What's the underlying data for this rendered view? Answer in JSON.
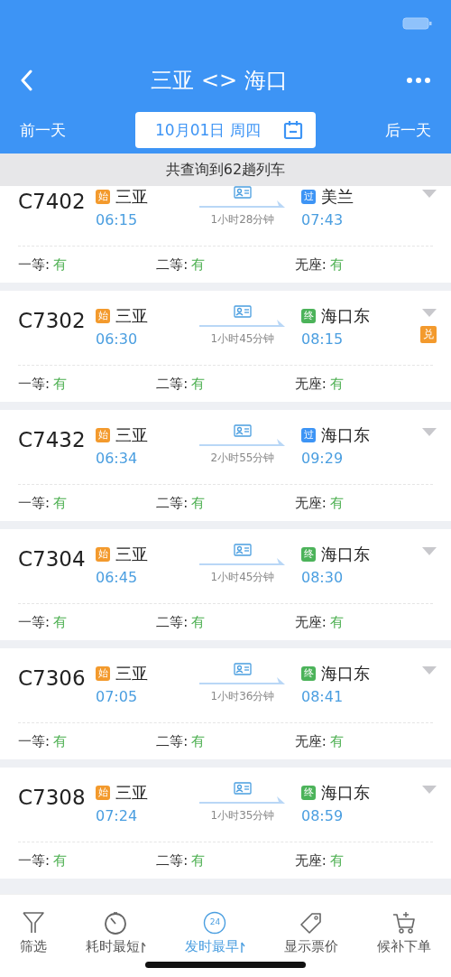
{
  "header": {
    "title": "三亚 <> 海口",
    "prev_day": "前一天",
    "date": "10月01日 周四",
    "next_day": "后一天"
  },
  "summary": "共查询到62趟列车",
  "trains": [
    {
      "number": "C7402",
      "from": {
        "badge": "始",
        "kind": "start",
        "name": "三亚"
      },
      "depart": "06:15",
      "duration": "1小时28分钟",
      "to": {
        "badge": "过",
        "kind": "pass",
        "name": "美兰"
      },
      "arrive": "07:43",
      "seats": [
        {
          "label": "一等:",
          "value": "有"
        },
        {
          "label": "二等:",
          "value": "有"
        },
        {
          "label": "无座:",
          "value": "有"
        }
      ]
    },
    {
      "number": "C7302",
      "from": {
        "badge": "始",
        "kind": "start",
        "name": "三亚"
      },
      "depart": "06:30",
      "duration": "1小时45分钟",
      "to": {
        "badge": "终",
        "kind": "end",
        "name": "海口东"
      },
      "arrive": "08:15",
      "tag": "兑",
      "seats": [
        {
          "label": "一等:",
          "value": "有"
        },
        {
          "label": "二等:",
          "value": "有"
        },
        {
          "label": "无座:",
          "value": "有"
        }
      ]
    },
    {
      "number": "C7432",
      "from": {
        "badge": "始",
        "kind": "start",
        "name": "三亚"
      },
      "depart": "06:34",
      "duration": "2小时55分钟",
      "to": {
        "badge": "过",
        "kind": "pass",
        "name": "海口东"
      },
      "arrive": "09:29",
      "seats": [
        {
          "label": "一等:",
          "value": "有"
        },
        {
          "label": "二等:",
          "value": "有"
        },
        {
          "label": "无座:",
          "value": "有"
        }
      ]
    },
    {
      "number": "C7304",
      "from": {
        "badge": "始",
        "kind": "start",
        "name": "三亚"
      },
      "depart": "06:45",
      "duration": "1小时45分钟",
      "to": {
        "badge": "终",
        "kind": "end",
        "name": "海口东"
      },
      "arrive": "08:30",
      "seats": [
        {
          "label": "一等:",
          "value": "有"
        },
        {
          "label": "二等:",
          "value": "有"
        },
        {
          "label": "无座:",
          "value": "有"
        }
      ]
    },
    {
      "number": "C7306",
      "from": {
        "badge": "始",
        "kind": "start",
        "name": "三亚"
      },
      "depart": "07:05",
      "duration": "1小时36分钟",
      "to": {
        "badge": "终",
        "kind": "end",
        "name": "海口东"
      },
      "arrive": "08:41",
      "seats": [
        {
          "label": "一等:",
          "value": "有"
        },
        {
          "label": "二等:",
          "value": "有"
        },
        {
          "label": "无座:",
          "value": "有"
        }
      ]
    },
    {
      "number": "C7308",
      "from": {
        "badge": "始",
        "kind": "start",
        "name": "三亚"
      },
      "depart": "07:24",
      "duration": "1小时35分钟",
      "to": {
        "badge": "终",
        "kind": "end",
        "name": "海口东"
      },
      "arrive": "08:59",
      "seats": [
        {
          "label": "一等:",
          "value": "有"
        },
        {
          "label": "二等:",
          "value": "有"
        },
        {
          "label": "无座:",
          "value": "有"
        }
      ]
    }
  ],
  "tabs": [
    {
      "label": "筛选",
      "kind": "filter",
      "sortable": false,
      "selected": false
    },
    {
      "label": "耗时最短",
      "kind": "timer",
      "sortable": true,
      "selected": false
    },
    {
      "label": "发时最早",
      "kind": "clock24",
      "icon_text": "24",
      "sortable": true,
      "selected": true
    },
    {
      "label": "显示票价",
      "kind": "tag",
      "sortable": false,
      "selected": false
    },
    {
      "label": "候补下单",
      "kind": "cart",
      "sortable": false,
      "selected": false
    }
  ]
}
